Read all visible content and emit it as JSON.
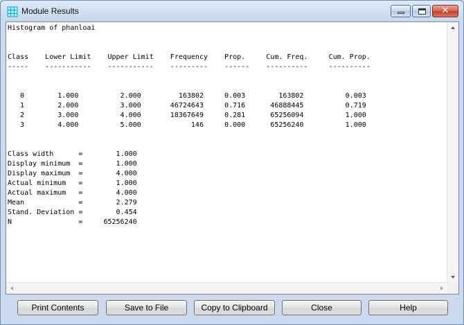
{
  "window": {
    "title": "Module Results"
  },
  "output": {
    "text": "Histogram of phanloai\n\n\nClass    Lower Limit    Upper Limit    Frequency    Prop.     Cum. Freq.     Cum. Prop.\n-----    -----------    -----------    ---------    ------    ----------     ----------\n\n\n   0        1.000          2.000         163802     0.003        163802          0.003\n   1        2.000          3.000       46724643     0.716      46888445          0.719\n   2        3.000          4.000       18367649     0.281      65256094          1.000\n   3        4.000          5.000            146     0.000      65256240          1.000\n\n\nClass width      =        1.000\nDisplay minimum  =        1.000\nDisplay maximum  =        4.000\nActual minimum   =        1.000\nActual maximum   =        4.000\nMean             =        2.279\nStand. Deviation =        0.454\nN                =     65256240"
  },
  "buttons": {
    "print": "Print Contents",
    "save": "Save to File",
    "copy": "Copy to Clipboard",
    "close": "Close",
    "help": "Help"
  },
  "colors": {
    "window_frame": "#c6d8ee",
    "close_button": "#c33e27"
  },
  "icons": {
    "app": "grid-icon",
    "minimize": "minimize-icon",
    "maximize": "maximize-icon",
    "close": "close-icon"
  }
}
